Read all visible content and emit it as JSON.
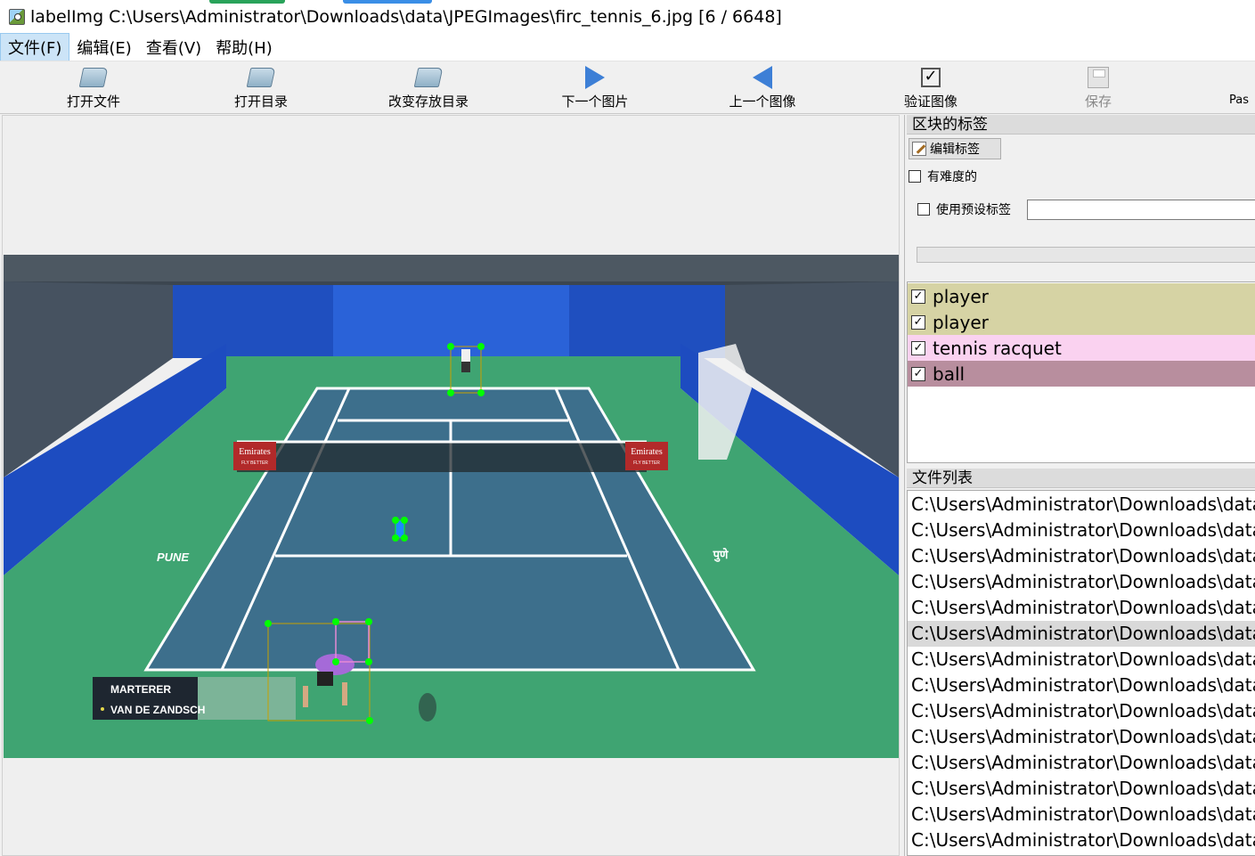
{
  "window": {
    "title": "labelImg C:\\Users\\Administrator\\Downloads\\data\\JPEGImages\\firc_tennis_6.jpg [6 / 6648]"
  },
  "menu": [
    "文件(F)",
    "编辑(E)",
    "查看(V)",
    "帮助(H)"
  ],
  "toolbar": {
    "open_file": "打开文件",
    "open_dir": "打开目录",
    "change_save_dir": "改变存放目录",
    "next_image": "下一个图片",
    "prev_image": "上一个图像",
    "verify_image": "验证图像",
    "save": "保存",
    "paste": "Pas"
  },
  "box_labels": {
    "title": "区块的标签",
    "edit_label_button": "编辑标签",
    "difficult_label": "有难度的",
    "use_default_label": "使用预设标签",
    "default_label_value": "",
    "items": [
      {
        "label": "player",
        "checked": true,
        "color": "#d6d3a4"
      },
      {
        "label": "player",
        "checked": true,
        "color": "#d6d3a4"
      },
      {
        "label": "tennis racquet",
        "checked": true,
        "color": "#fad2f0"
      },
      {
        "label": "ball",
        "checked": true,
        "color": "#b88e9e"
      }
    ]
  },
  "file_list": {
    "title": "文件列表",
    "selected_index": 5,
    "items": [
      "C:\\Users\\Administrator\\Downloads\\data\\",
      "C:\\Users\\Administrator\\Downloads\\data\\",
      "C:\\Users\\Administrator\\Downloads\\data\\",
      "C:\\Users\\Administrator\\Downloads\\data\\",
      "C:\\Users\\Administrator\\Downloads\\data\\",
      "C:\\Users\\Administrator\\Downloads\\data\\",
      "C:\\Users\\Administrator\\Downloads\\data\\",
      "C:\\Users\\Administrator\\Downloads\\data\\",
      "C:\\Users\\Administrator\\Downloads\\data\\",
      "C:\\Users\\Administrator\\Downloads\\data\\",
      "C:\\Users\\Administrator\\Downloads\\data\\",
      "C:\\Users\\Administrator\\Downloads\\data\\",
      "C:\\Users\\Administrator\\Downloads\\data\\",
      "C:\\Users\\Administrator\\Downloads\\data\\"
    ]
  },
  "image": {
    "banner_text_left": "Emirates",
    "banner_text_right": "Emirates",
    "banner_sub": "FLY BETTER",
    "court_text_left": "PUNE",
    "court_text_right": "पुणे",
    "score_player_1": "MARTERER",
    "score_player_2": "VAN DE ZANDSCH"
  },
  "colors": {
    "court_blue": "#3d6f8c",
    "court_green": "#3fa472",
    "wall_blue": "#1f4fbf",
    "bbox_green": "#00ff00"
  }
}
